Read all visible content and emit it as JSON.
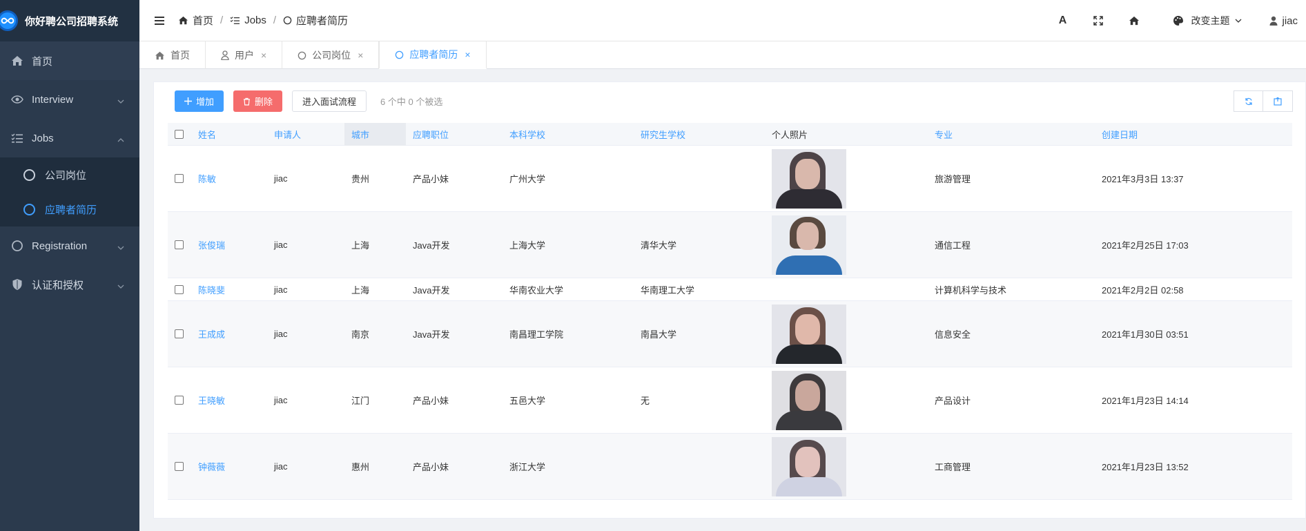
{
  "app": {
    "title": "你好聘公司招聘系统"
  },
  "sidebar": {
    "items": [
      {
        "label": "首页",
        "icon": "home-icon"
      },
      {
        "label": "Interview",
        "icon": "eye-icon"
      },
      {
        "label": "Jobs",
        "icon": "list-check-icon"
      },
      {
        "label": "Registration",
        "icon": "circle-icon"
      },
      {
        "label": "认证和授权",
        "icon": "shield-icon"
      }
    ],
    "jobs_sub": [
      {
        "label": "公司岗位",
        "active": false
      },
      {
        "label": "应聘者简历",
        "active": true
      }
    ]
  },
  "header": {
    "breadcrumb": [
      "首页",
      "Jobs",
      "应聘者简历"
    ],
    "theme_label": "改变主题",
    "user": "jiac"
  },
  "tabs": [
    {
      "label": "首页",
      "closable": false
    },
    {
      "label": "用户",
      "closable": true
    },
    {
      "label": "公司岗位",
      "closable": true
    },
    {
      "label": "应聘者简历",
      "closable": true,
      "active": true
    }
  ],
  "toolbar": {
    "add_label": "增加",
    "delete_label": "删除",
    "process_label": "进入面试流程",
    "selection": "6 个中 0 个被选"
  },
  "table": {
    "columns": [
      "姓名",
      "申请人",
      "城市",
      "应聘职位",
      "本科学校",
      "研究生学校",
      "个人照片",
      "专业",
      "创建日期"
    ],
    "rows": [
      {
        "name": "陈敏",
        "applicant": "jiac",
        "city": "贵州",
        "position": "产品小妹",
        "university": "广州大学",
        "grad_school": "",
        "photo": "portrait-dark",
        "major": "旅游管理",
        "created": "2021年3月3日 13:37"
      },
      {
        "name": "张俊瑞",
        "applicant": "jiac",
        "city": "上海",
        "position": "Java开发",
        "university": "上海大学",
        "grad_school": "清华大学",
        "photo": "portrait-blue",
        "major": "通信工程",
        "created": "2021年2月25日 17:03"
      },
      {
        "name": "陈晓斐",
        "applicant": "jiac",
        "city": "上海",
        "position": "Java开发",
        "university": "华南农业大学",
        "grad_school": "华南理工大学",
        "photo": "",
        "major": "计算机科学与技术",
        "created": "2021年2月2日 02:58"
      },
      {
        "name": "王成成",
        "applicant": "jiac",
        "city": "南京",
        "position": "Java开发",
        "university": "南昌理工学院",
        "grad_school": "南昌大学",
        "photo": "portrait-dark",
        "major": "信息安全",
        "created": "2021年1月30日 03:51"
      },
      {
        "name": "王晓敏",
        "applicant": "jiac",
        "city": "江门",
        "position": "产品小妹",
        "university": "五邑大学",
        "grad_school": "无",
        "photo": "portrait-dark",
        "major": "产品设计",
        "created": "2021年1月23日 14:14"
      },
      {
        "name": "钟薇薇",
        "applicant": "jiac",
        "city": "惠州",
        "position": "产品小妹",
        "university": "浙江大学",
        "grad_school": "",
        "photo": "portrait-light",
        "major": "工商管理",
        "created": "2021年1月23日 13:52"
      }
    ]
  },
  "colors": {
    "primary": "#409eff",
    "danger": "#f56c6c",
    "sidebar": "#2b3a4d"
  }
}
